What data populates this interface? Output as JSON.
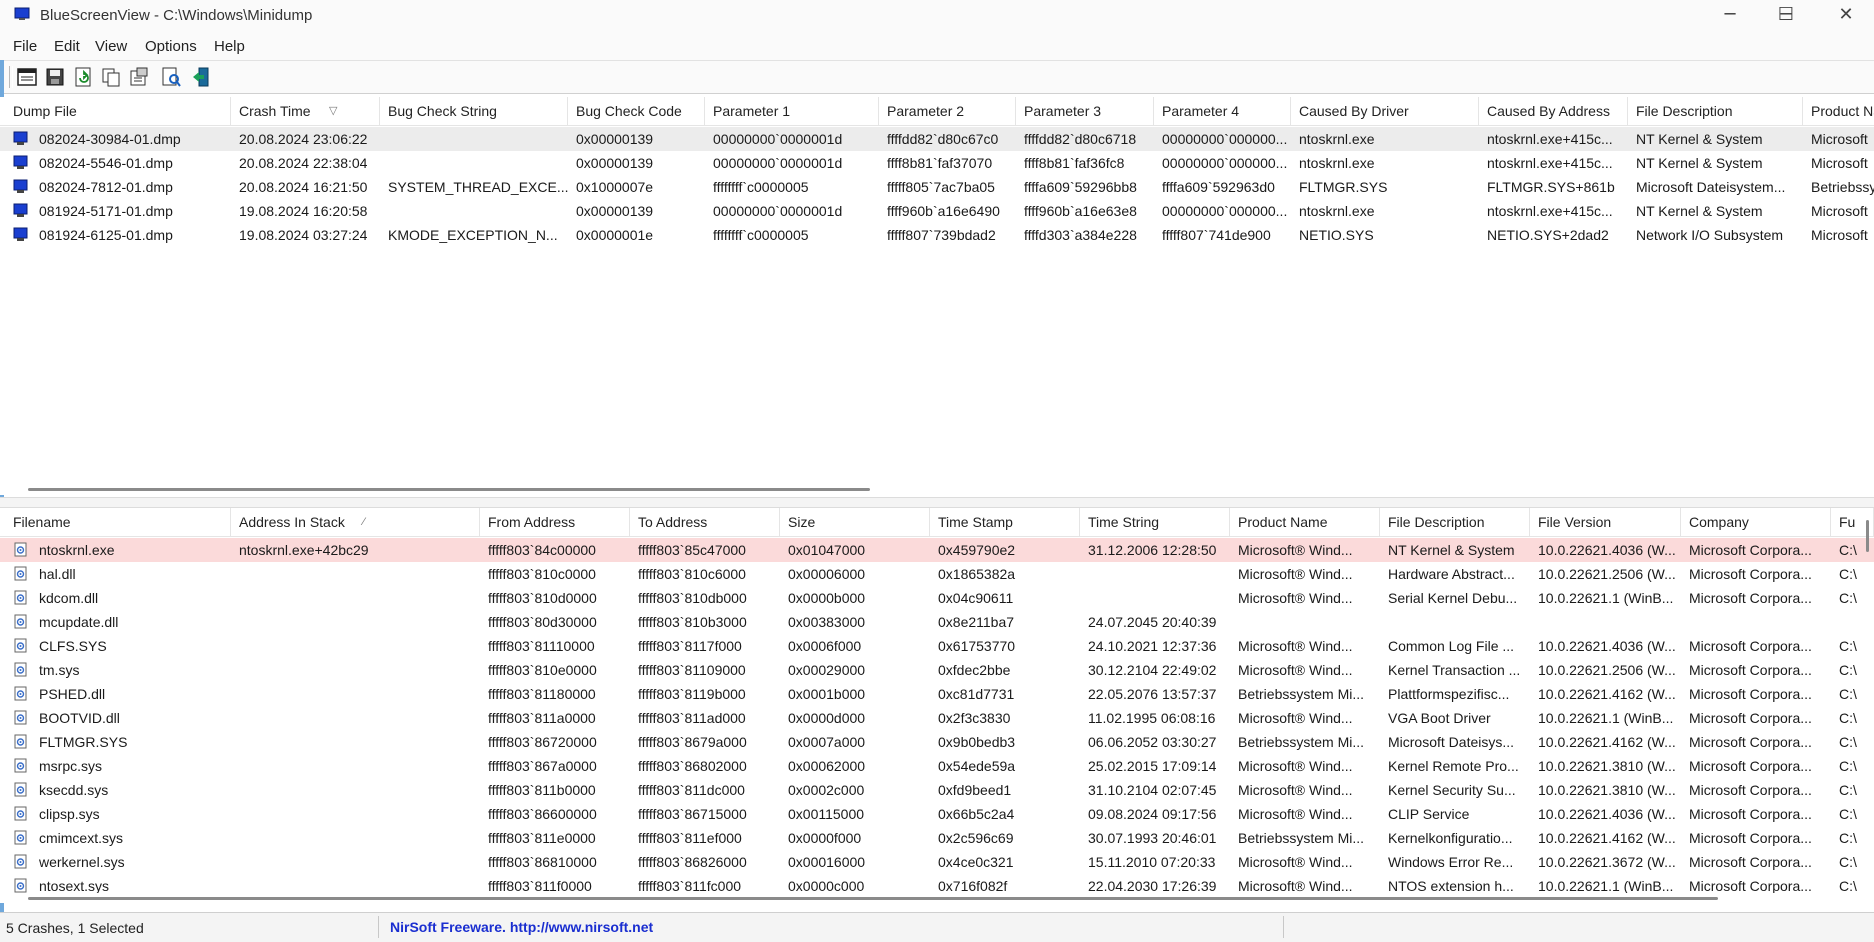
{
  "window": {
    "title": "BlueScreenView  -  C:\\Windows\\Minidump",
    "minimize_glyph": "─",
    "maximize_glyph": "☐",
    "close_glyph": "✕"
  },
  "menu": [
    "File",
    "Edit",
    "View",
    "Options",
    "Help"
  ],
  "toolbar": {
    "buttons": [
      "html-report-icon",
      "save-icon",
      "refresh-icon",
      "copy-icon",
      "properties-icon",
      "find-icon",
      "exit-icon"
    ]
  },
  "crashes": {
    "columns": [
      "Dump File",
      "Crash Time",
      "Bug Check String",
      "Bug Check Code",
      "Parameter 1",
      "Parameter 2",
      "Parameter 3",
      "Parameter 4",
      "Caused By Driver",
      "Caused By Address",
      "File Description",
      "Product Na"
    ],
    "sort_indicator": "▽",
    "rows": [
      [
        "082024-30984-01.dmp",
        "20.08.2024 23:06:22",
        "",
        "0x00000139",
        "00000000`0000001d",
        "ffffdd82`d80c67c0",
        "ffffdd82`d80c6718",
        "00000000`000000...",
        "ntoskrnl.exe",
        "ntoskrnl.exe+415c...",
        "NT Kernel & System",
        "Microsoft"
      ],
      [
        "082024-5546-01.dmp",
        "20.08.2024 22:38:04",
        "",
        "0x00000139",
        "00000000`0000001d",
        "ffff8b81`faf37070",
        "ffff8b81`faf36fc8",
        "00000000`000000...",
        "ntoskrnl.exe",
        "ntoskrnl.exe+415c...",
        "NT Kernel & System",
        "Microsoft"
      ],
      [
        "082024-7812-01.dmp",
        "20.08.2024 16:21:50",
        "SYSTEM_THREAD_EXCE...",
        "0x1000007e",
        "ffffffff`c0000005",
        "fffff805`7ac7ba05",
        "ffffa609`59296bb8",
        "ffffa609`592963d0",
        "FLTMGR.SYS",
        "FLTMGR.SYS+861b",
        "Microsoft Dateisystem...",
        "Betriebssy"
      ],
      [
        "081924-5171-01.dmp",
        "19.08.2024 16:20:58",
        "",
        "0x00000139",
        "00000000`0000001d",
        "ffff960b`a16e6490",
        "ffff960b`a16e63e8",
        "00000000`000000...",
        "ntoskrnl.exe",
        "ntoskrnl.exe+415c...",
        "NT Kernel & System",
        "Microsoft"
      ],
      [
        "081924-6125-01.dmp",
        "19.08.2024 03:27:24",
        "KMODE_EXCEPTION_N...",
        "0x0000001e",
        "ffffffff`c0000005",
        "fffff807`739bdad2",
        "ffffd303`a384e228",
        "fffff807`741de900",
        "NETIO.SYS",
        "NETIO.SYS+2dad2",
        "Network I/O Subsystem",
        "Microsoft"
      ]
    ]
  },
  "drivers": {
    "columns": [
      "Filename",
      "Address In Stack",
      "From Address",
      "To Address",
      "Size",
      "Time Stamp",
      "Time String",
      "Product Name",
      "File Description",
      "File Version",
      "Company",
      "Fu"
    ],
    "sort_indicator": "⁄",
    "rows": [
      [
        "ntoskrnl.exe",
        "ntoskrnl.exe+42bc29",
        "fffff803`84c00000",
        "fffff803`85c47000",
        "0x01047000",
        "0x459790e2",
        "31.12.2006 12:28:50",
        "Microsoft® Wind...",
        "NT Kernel & System",
        "10.0.22621.4036 (W...",
        "Microsoft Corpora...",
        "C:\\"
      ],
      [
        "hal.dll",
        "",
        "fffff803`810c0000",
        "fffff803`810c6000",
        "0x00006000",
        "0x1865382a",
        "",
        "Microsoft® Wind...",
        "Hardware Abstract...",
        "10.0.22621.2506 (W...",
        "Microsoft Corpora...",
        "C:\\"
      ],
      [
        "kdcom.dll",
        "",
        "fffff803`810d0000",
        "fffff803`810db000",
        "0x0000b000",
        "0x04c90611",
        "",
        "Microsoft® Wind...",
        "Serial Kernel Debu...",
        "10.0.22621.1 (WinB...",
        "Microsoft Corpora...",
        "C:\\"
      ],
      [
        "mcupdate.dll",
        "",
        "fffff803`80d30000",
        "fffff803`810b3000",
        "0x00383000",
        "0x8e211ba7",
        "24.07.2045 20:40:39",
        "",
        "",
        "",
        "",
        ""
      ],
      [
        "CLFS.SYS",
        "",
        "fffff803`81110000",
        "fffff803`8117f000",
        "0x0006f000",
        "0x61753770",
        "24.10.2021 12:37:36",
        "Microsoft® Wind...",
        "Common Log File ...",
        "10.0.22621.4036 (W...",
        "Microsoft Corpora...",
        "C:\\"
      ],
      [
        "tm.sys",
        "",
        "fffff803`810e0000",
        "fffff803`81109000",
        "0x00029000",
        "0xfdec2bbe",
        "30.12.2104 22:49:02",
        "Microsoft® Wind...",
        "Kernel Transaction ...",
        "10.0.22621.2506 (W...",
        "Microsoft Corpora...",
        "C:\\"
      ],
      [
        "PSHED.dll",
        "",
        "fffff803`81180000",
        "fffff803`8119b000",
        "0x0001b000",
        "0xc81d7731",
        "22.05.2076 13:57:37",
        "Betriebssystem Mi...",
        "Plattformspezifisc...",
        "10.0.22621.4162 (W...",
        "Microsoft Corpora...",
        "C:\\"
      ],
      [
        "BOOTVID.dll",
        "",
        "fffff803`811a0000",
        "fffff803`811ad000",
        "0x0000d000",
        "0x2f3c3830",
        "11.02.1995 06:08:16",
        "Microsoft® Wind...",
        "VGA Boot Driver",
        "10.0.22621.1 (WinB...",
        "Microsoft Corpora...",
        "C:\\"
      ],
      [
        "FLTMGR.SYS",
        "",
        "fffff803`86720000",
        "fffff803`8679a000",
        "0x0007a000",
        "0x9b0bedb3",
        "06.06.2052 03:30:27",
        "Betriebssystem Mi...",
        "Microsoft Dateisys...",
        "10.0.22621.4162 (W...",
        "Microsoft Corpora...",
        "C:\\"
      ],
      [
        "msrpc.sys",
        "",
        "fffff803`867a0000",
        "fffff803`86802000",
        "0x00062000",
        "0x54ede59a",
        "25.02.2015 17:09:14",
        "Microsoft® Wind...",
        "Kernel Remote Pro...",
        "10.0.22621.3810 (W...",
        "Microsoft Corpora...",
        "C:\\"
      ],
      [
        "ksecdd.sys",
        "",
        "fffff803`811b0000",
        "fffff803`811dc000",
        "0x0002c000",
        "0xfd9beed1",
        "31.10.2104 02:07:45",
        "Microsoft® Wind...",
        "Kernel Security Su...",
        "10.0.22621.3810 (W...",
        "Microsoft Corpora...",
        "C:\\"
      ],
      [
        "clipsp.sys",
        "",
        "fffff803`86600000",
        "fffff803`86715000",
        "0x00115000",
        "0x66b5c2a4",
        "09.08.2024 09:17:56",
        "Microsoft® Wind...",
        "CLIP Service",
        "10.0.22621.4036 (W...",
        "Microsoft Corpora...",
        "C:\\"
      ],
      [
        "cmimcext.sys",
        "",
        "fffff803`811e0000",
        "fffff803`811ef000",
        "0x0000f000",
        "0x2c596c69",
        "30.07.1993 20:46:01",
        "Betriebssystem Mi...",
        "Kernelkonfiguratio...",
        "10.0.22621.4162 (W...",
        "Microsoft Corpora...",
        "C:\\"
      ],
      [
        "werkernel.sys",
        "",
        "fffff803`86810000",
        "fffff803`86826000",
        "0x00016000",
        "0x4ce0c321",
        "15.11.2010 07:20:33",
        "Microsoft® Wind...",
        "Windows Error Re...",
        "10.0.22621.3672 (W...",
        "Microsoft Corpora...",
        "C:\\"
      ],
      [
        "ntosext.sys",
        "",
        "fffff803`811f0000",
        "fffff803`811fc000",
        "0x0000c000",
        "0x716f082f",
        "22.04.2030 17:26:39",
        "Microsoft® Wind...",
        "NTOS extension h...",
        "10.0.22621.1 (WinB...",
        "Microsoft Corpora...",
        "C:\\"
      ]
    ]
  },
  "status": {
    "summary": "5 Crashes, 1 Selected",
    "link": "NirSoft Freeware.  http://www.nirsoft.net"
  },
  "colors": {
    "selected_row": "#ececec",
    "highlighted_driver_row": "#fbdada",
    "link": "#1a2ed0"
  }
}
